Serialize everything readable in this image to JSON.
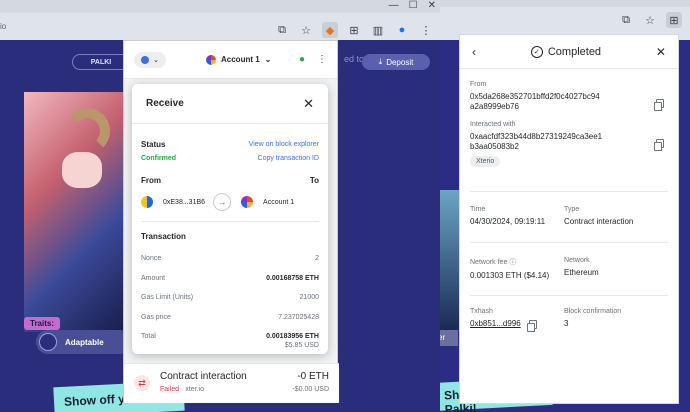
{
  "front_browser": {
    "url_fragment": "io",
    "site": {
      "nav_pill_label": "PALKI",
      "record_link": "ed to Record",
      "deposit_label": "Deposit",
      "traits_label": "Traits:",
      "trait_name": "Adaptable",
      "showoff_banner": "Show off your Palki!"
    }
  },
  "back_browser": {
    "side_label": "ker",
    "showoff_banner": "Show off your Palki!"
  },
  "metamask": {
    "network_initial": "E",
    "account_name": "Account 1",
    "activity": {
      "title": "Contract interaction",
      "status": "Failed",
      "origin": "xter.io",
      "amount": "-0 ETH",
      "usd": "-$0.00 USD"
    },
    "receive_modal": {
      "title": "Receive",
      "status_label": "Status",
      "status_value": "Confirmed",
      "view_explorer": "View on block explorer",
      "copy_tx_id": "Copy transaction ID",
      "from_label": "From",
      "to_label": "To",
      "from_address": "0xE38...31B6",
      "to_account": "Account 1",
      "transaction_label": "Transaction",
      "rows": [
        {
          "label": "Nonce",
          "value": "2"
        },
        {
          "label": "Amount",
          "value": "0.00168758 ETH"
        },
        {
          "label": "Gas Limit (Units)",
          "value": "21000"
        },
        {
          "label": "Gas price",
          "value": "7.237025428"
        },
        {
          "label": "Total",
          "value": "0.00183956 ETH"
        }
      ],
      "total_usd": "$5.85 USD"
    }
  },
  "completed_panel": {
    "title": "Completed",
    "from_label": "From",
    "from_address_line1": "0x5da268e352701bffd2f0c4027bc94",
    "from_address_line2": "a2a8999eb76",
    "interacted_label": "Interacted with",
    "interacted_line1": "0xaacfdf323b44d8b27319249ca3ee1",
    "interacted_line2": "b3aa05083b2",
    "interacted_chip": "Xterio",
    "time_label": "Time",
    "time_value": "04/30/2024, 09:19:11",
    "type_label": "Type",
    "type_value": "Contract interaction",
    "fee_label": "Network fee",
    "fee_value": "0.001303 ETH ($4.14)",
    "network_label": "Network",
    "network_value": "Ethereum",
    "txhash_label": "Txhash",
    "txhash_value": "0xb851...d996",
    "confirm_label": "Block confirmation",
    "confirm_value": "3"
  }
}
